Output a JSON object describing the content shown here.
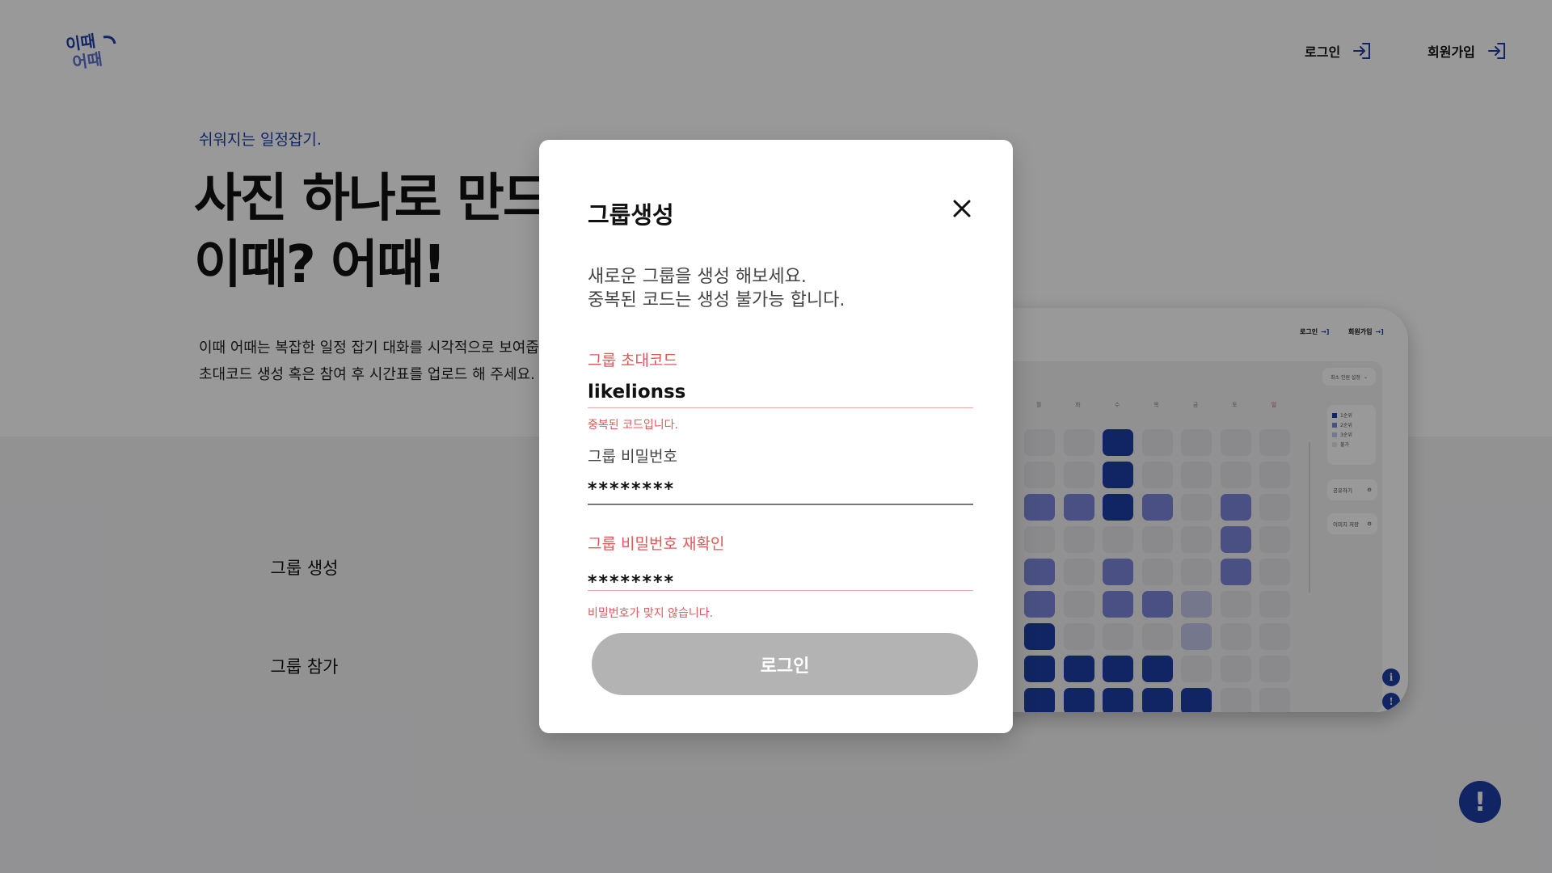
{
  "header": {
    "logo_text": "이때 어때",
    "login_label": "로그인",
    "signup_label": "회원가입"
  },
  "hero": {
    "tagline": "쉬워지는 일정잡기.",
    "title_line1": "사진 하나로 만드는",
    "title_line2": "이때? 어때!",
    "desc_line1": "이때 어때는 복잡한 일정 잡기 대화를 시각적으로 보여줍니다.",
    "desc_line2": "초대코드 생성 혹은 참여 후 시간표를 업로드 해 주세요."
  },
  "buttons": {
    "create_group": "그룹 생성",
    "join_group": "그룹 참가"
  },
  "preview": {
    "nav_login": "로그인",
    "nav_signup": "회원가입",
    "dropdown": "최소 인원 설정",
    "days": [
      "월",
      "화",
      "수",
      "목",
      "금",
      "토",
      "일"
    ],
    "legend": [
      "1순위",
      "2순위",
      "3순위",
      "불가"
    ],
    "share_label": "공유하기",
    "save_label": "이미지 저장",
    "grid_levels": [
      [
        0,
        0,
        1,
        0,
        0,
        0,
        0
      ],
      [
        0,
        0,
        1,
        0,
        0,
        0,
        0
      ],
      [
        2,
        2,
        1,
        2,
        0,
        2,
        0
      ],
      [
        0,
        0,
        0,
        0,
        0,
        2,
        0
      ],
      [
        2,
        0,
        2,
        0,
        0,
        2,
        0
      ],
      [
        2,
        0,
        2,
        2,
        3,
        0,
        0
      ],
      [
        1,
        0,
        0,
        0,
        3,
        0,
        0
      ],
      [
        1,
        1,
        1,
        1,
        0,
        0,
        0
      ],
      [
        1,
        1,
        1,
        1,
        1,
        0,
        0
      ]
    ]
  },
  "modal": {
    "title": "그룹생성",
    "desc_line1": "새로운 그룹을 생성 해보세요.",
    "desc_line2": "중복된 코드는 생성 불가능 합니다.",
    "code_label": "그룹 초대코드",
    "code_value": "likelionss",
    "code_error": "중복된 코드입니다.",
    "pw_label": "그룹 비밀번호",
    "pw_value": "********",
    "pw_confirm_label": "그룹 비밀번호 재확인",
    "pw_confirm_value": "********",
    "pw_error": "비밀번호가 맞지 않습니다.",
    "submit_label": "로그인"
  },
  "colors": {
    "brand": "#1d3fa8",
    "error": "#e0585a",
    "disabled": "#b3b3b3"
  }
}
